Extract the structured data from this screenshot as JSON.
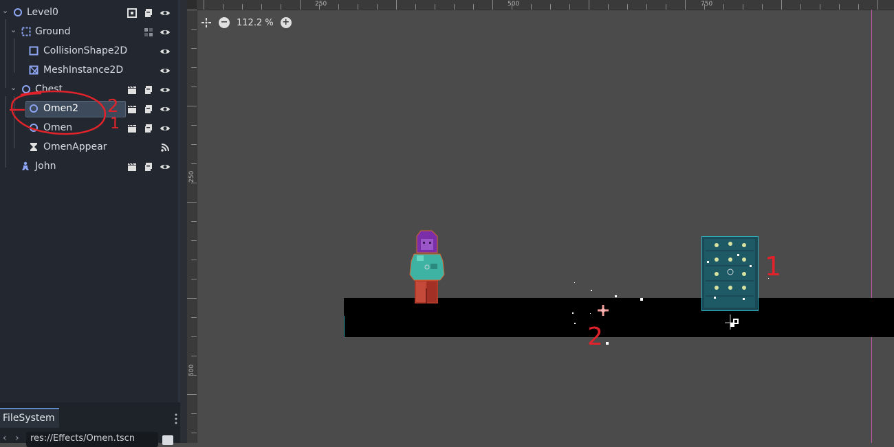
{
  "scene_tree": {
    "nodes": [
      {
        "label": "Level0",
        "icon": "node2d-circle-icon",
        "actions": [
          "group-icon",
          "script-icon",
          "eye-icon"
        ]
      },
      {
        "label": "Ground",
        "icon": "staticbody-icon",
        "actions": [
          "grid-icon",
          "eye-icon"
        ]
      },
      {
        "label": "CollisionShape2D",
        "icon": "collision-shape-icon",
        "actions": [
          "eye-icon"
        ]
      },
      {
        "label": "MeshInstance2D",
        "icon": "mesh-icon",
        "actions": [
          "eye-icon"
        ]
      },
      {
        "label": "Chest",
        "icon": "node2d-circle-icon",
        "actions": [
          "clapper-icon",
          "script-icon",
          "eye-icon"
        ]
      },
      {
        "label": "Omen2",
        "icon": "node2d-circle-icon",
        "actions": [
          "clapper-icon",
          "script-icon",
          "eye-icon"
        ],
        "selected": true
      },
      {
        "label": "Omen",
        "icon": "node2d-circle-icon",
        "actions": [
          "clapper-icon",
          "script-icon",
          "eye-icon"
        ]
      },
      {
        "label": "OmenAppear",
        "icon": "hourglass-icon",
        "actions": [
          "signal-icon"
        ]
      },
      {
        "label": "John",
        "icon": "character-icon",
        "actions": [
          "clapper-icon",
          "script-icon",
          "eye-icon"
        ]
      }
    ]
  },
  "filesystem": {
    "tab_label": "FileSystem",
    "path": "res://Effects/Omen.tscn"
  },
  "viewport": {
    "zoom": "112.2 %",
    "ruler_top_labels": [
      "250",
      "500",
      "750"
    ],
    "ruler_left_labels": [
      "250",
      "500"
    ]
  },
  "annotations": [
    "2",
    "1",
    "2",
    "1"
  ],
  "colors": {
    "accent": "#5e89c6",
    "selection": "#3c4a5c",
    "guide_line": "#c05aa8",
    "annotation": "#e0232a"
  }
}
